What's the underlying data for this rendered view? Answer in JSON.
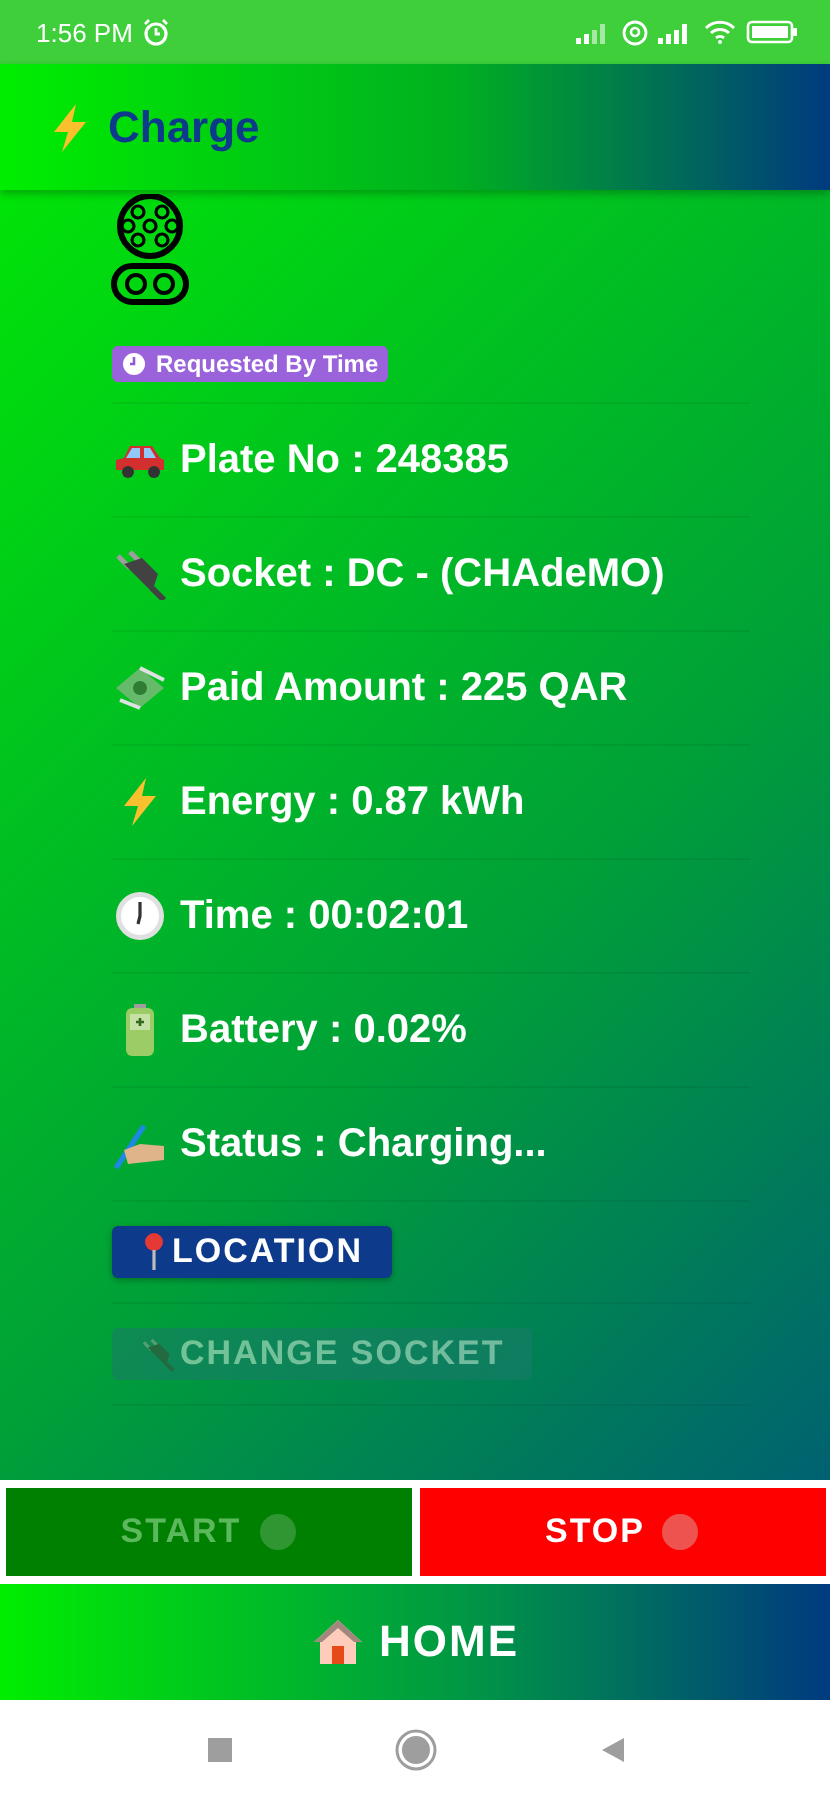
{
  "status_bar": {
    "time": "1:56 PM"
  },
  "header": {
    "title": "Charge"
  },
  "badge": {
    "label": "Requested By Time"
  },
  "info_rows": [
    {
      "kind": "car",
      "text": "Plate No : 248385"
    },
    {
      "kind": "plug",
      "text": "Socket : DC - (CHAdeMO)"
    },
    {
      "kind": "money",
      "text": "Paid Amount : 225 QAR"
    },
    {
      "kind": "bolt",
      "text": "Energy : 0.87 kWh"
    },
    {
      "kind": "clock",
      "text": "Time : 00:02:01"
    },
    {
      "kind": "battery",
      "text": "Battery : 0.02%"
    },
    {
      "kind": "writing",
      "text": "Status : Charging..."
    }
  ],
  "actions": [
    {
      "kind": "location",
      "label": "LOCATION",
      "disabled": false
    },
    {
      "kind": "socket",
      "label": "CHANGE SOCKET",
      "disabled": true
    }
  ],
  "controls": [
    {
      "kind": "start",
      "label": "START",
      "disabled": true
    },
    {
      "kind": "stop",
      "label": "STOP",
      "disabled": false
    }
  ],
  "home_button": {
    "label": "HOME"
  }
}
